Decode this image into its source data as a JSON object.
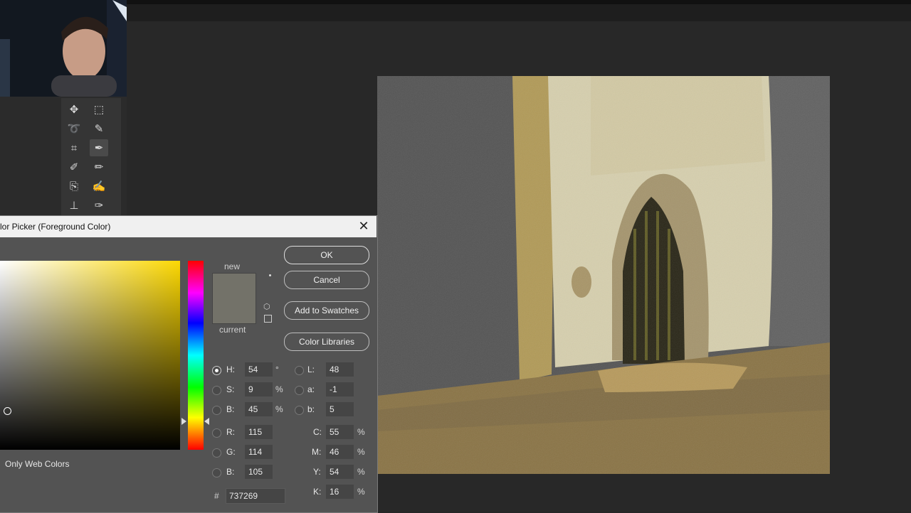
{
  "dialog": {
    "title": "lor Picker (Foreground Color)",
    "close_glyph": "✕",
    "new_label": "new",
    "current_label": "current",
    "ok_label": "OK",
    "cancel_label": "Cancel",
    "add_swatches_label": "Add to Swatches",
    "color_libraries_label": "Color Libraries",
    "only_web_colors_label": "Only Web Colors",
    "hex_symbol": "#",
    "hex_value": "737269",
    "new_color": "#737269",
    "current_color": "#737269",
    "selected_mode": "H",
    "hsb": [
      {
        "label": "H:",
        "value": "54",
        "unit": "°"
      },
      {
        "label": "S:",
        "value": "9",
        "unit": "%"
      },
      {
        "label": "B:",
        "value": "45",
        "unit": "%"
      }
    ],
    "rgb": [
      {
        "label": "R:",
        "value": "115"
      },
      {
        "label": "G:",
        "value": "114"
      },
      {
        "label": "B:",
        "value": "105"
      }
    ],
    "lab": [
      {
        "label": "L:",
        "value": "48"
      },
      {
        "label": "a:",
        "value": "-1"
      },
      {
        "label": "b:",
        "value": "5"
      }
    ],
    "cmyk": [
      {
        "label": "C:",
        "value": "55",
        "unit": "%"
      },
      {
        "label": "M:",
        "value": "46",
        "unit": "%"
      },
      {
        "label": "Y:",
        "value": "54",
        "unit": "%"
      },
      {
        "label": "K:",
        "value": "16",
        "unit": "%"
      }
    ]
  },
  "toolbar": {
    "tools": [
      {
        "name": "move-tool",
        "glyph": "✥"
      },
      {
        "name": "marquee-tool",
        "glyph": "⬚"
      },
      {
        "name": "lasso-tool",
        "glyph": "➰"
      },
      {
        "name": "quick-select-tool",
        "glyph": "✎"
      },
      {
        "name": "crop-tool",
        "glyph": "⌗"
      },
      {
        "name": "eyedropper-tool",
        "glyph": "✒"
      },
      {
        "name": "brush-tool",
        "glyph": "✐"
      },
      {
        "name": "pencil-tool",
        "glyph": "✏"
      },
      {
        "name": "clone-tool",
        "glyph": "⎘"
      },
      {
        "name": "history-brush-tool",
        "glyph": "✍"
      },
      {
        "name": "stamp-tool",
        "glyph": "⊥"
      },
      {
        "name": "art-history-tool",
        "glyph": "✑"
      }
    ]
  },
  "colors": {
    "dialog_bg": "#535353",
    "canvas_bg": "#555555",
    "wall": "#d6cfae",
    "ground": "#8a7446"
  }
}
